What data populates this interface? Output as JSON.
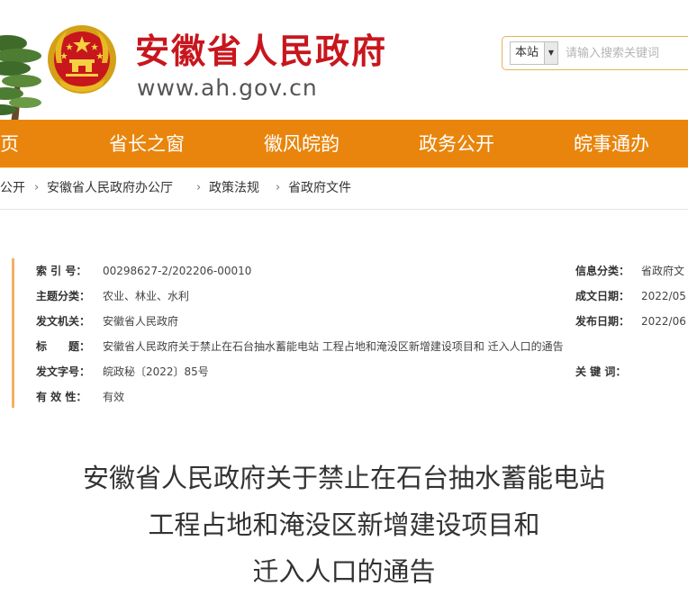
{
  "header": {
    "site_title": "安徽省人民政府",
    "site_url": "www.ah.gov.cn",
    "emblem_icon": "national-emblem-icon",
    "decoration_icon": "pine-tree-icon",
    "search": {
      "scope": "本站",
      "placeholder": "请输入搜索关键词"
    }
  },
  "nav": {
    "items": [
      {
        "label": "页"
      },
      {
        "label": "省长之窗"
      },
      {
        "label": "徽风皖韵"
      },
      {
        "label": "政务公开"
      },
      {
        "label": "皖事通办"
      }
    ],
    "bar_color": "#e9850c"
  },
  "breadcrumb": [
    "公开",
    "安徽省人民政府办公厅",
    "政策法规",
    "省政府文件"
  ],
  "info": {
    "index_no": {
      "label": "索 引 号：",
      "value": "00298627-2/202206-00010"
    },
    "subject": {
      "label": "主题分类：",
      "value": "农业、林业、水利"
    },
    "issuer": {
      "label": "发文机关：",
      "value": "安徽省人民政府"
    },
    "title": {
      "label": "标　　题：",
      "value": "安徽省人民政府关于禁止在石台抽水蓄能电站 工程占地和淹没区新增建设项目和 迁入人口的通告"
    },
    "doc_no": {
      "label": "发文字号：",
      "value": "皖政秘〔2022〕85号"
    },
    "validity": {
      "label": "有 效 性：",
      "value": "有效"
    },
    "category": {
      "label": "信息分类：",
      "value": "省政府文"
    },
    "date_made": {
      "label": "成文日期：",
      "value": "2022/05"
    },
    "date_published": {
      "label": "发布日期：",
      "value": "2022/06"
    },
    "keywords": {
      "label": "关 键 词：",
      "value": ""
    }
  },
  "article": {
    "title_lines": [
      "安徽省人民政府关于禁止在石台抽水蓄能电站",
      "工程占地和淹没区新增建设项目和",
      "迁入人口的通告"
    ]
  }
}
